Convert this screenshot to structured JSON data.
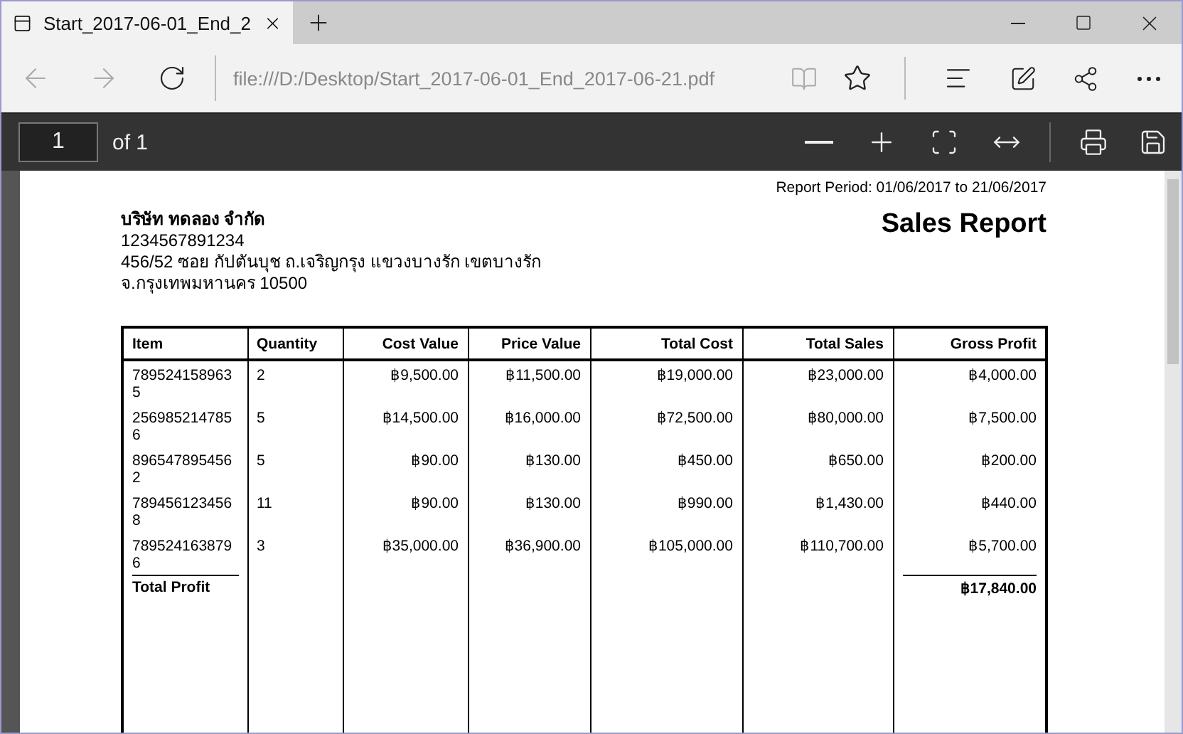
{
  "tab": {
    "title": "Start_2017-06-01_End_2"
  },
  "address_bar": {
    "url": "file:///D:/Desktop/Start_2017-06-01_End_2017-06-21.pdf"
  },
  "pdf_toolbar": {
    "page_number": "1",
    "page_total": "of 1"
  },
  "report": {
    "period": "Report Period: 01/06/2017 to 21/06/2017",
    "title": "Sales Report",
    "company": [
      "บริษัท ทดลอง จำกัด",
      "1234567891234",
      "456/52 ซอย กัปตันบุช ถ.เจริญกรุง แขวงบางรัก เขตบางรัก",
      "จ.กรุงเทพมหานคร 10500"
    ],
    "table": {
      "columns": [
        "Item",
        "Quantity",
        "Cost Value",
        "Price Value",
        "Total Cost",
        "Total Sales",
        "Gross Profit"
      ],
      "rows": [
        [
          "7895241589635",
          "2",
          "฿9,500.00",
          "฿11,500.00",
          "฿19,000.00",
          "฿23,000.00",
          "฿4,000.00"
        ],
        [
          "2569852147856",
          "5",
          "฿14,500.00",
          "฿16,000.00",
          "฿72,500.00",
          "฿80,000.00",
          "฿7,500.00"
        ],
        [
          "8965478954562",
          "5",
          "฿90.00",
          "฿130.00",
          "฿450.00",
          "฿650.00",
          "฿200.00"
        ],
        [
          "7894561234568",
          "11",
          "฿90.00",
          "฿130.00",
          "฿990.00",
          "฿1,430.00",
          "฿440.00"
        ],
        [
          "7895241638796",
          "3",
          "฿35,000.00",
          "฿36,900.00",
          "฿105,000.00",
          "฿110,700.00",
          "฿5,700.00"
        ]
      ],
      "total": {
        "label": "Total Profit",
        "value": "฿17,840.00"
      }
    }
  }
}
